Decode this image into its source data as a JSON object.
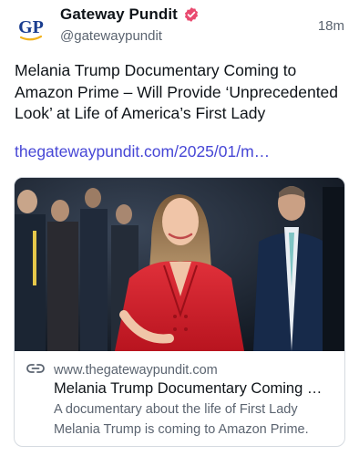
{
  "account": {
    "display_name": "Gateway Pundit",
    "handle": "@gatewaypundit",
    "avatar_text": "GP",
    "verified_icon": "verified-badge-icon",
    "badge_color": "#e94a6f",
    "brand_color": "#1a3d8f",
    "accent_color": "#f2b21b"
  },
  "post": {
    "timestamp": "18m",
    "text": "Melania Trump Documentary Coming to Amazon Prime – Will Provide ‘Unprecedented Look’ at Life of America’s First Lady",
    "link_text": "thegatewaypundit.com/2025/01/m…",
    "link_color": "#4747d6"
  },
  "card": {
    "image_description_icon": "link-preview-photo",
    "link_icon": "link-icon",
    "domain": "www.thegatewaypundit.com",
    "title": "Melania Trump Documentary Coming …",
    "description": "A documentary about the life of First Lady Melania Trump is coming to Amazon Prime."
  }
}
